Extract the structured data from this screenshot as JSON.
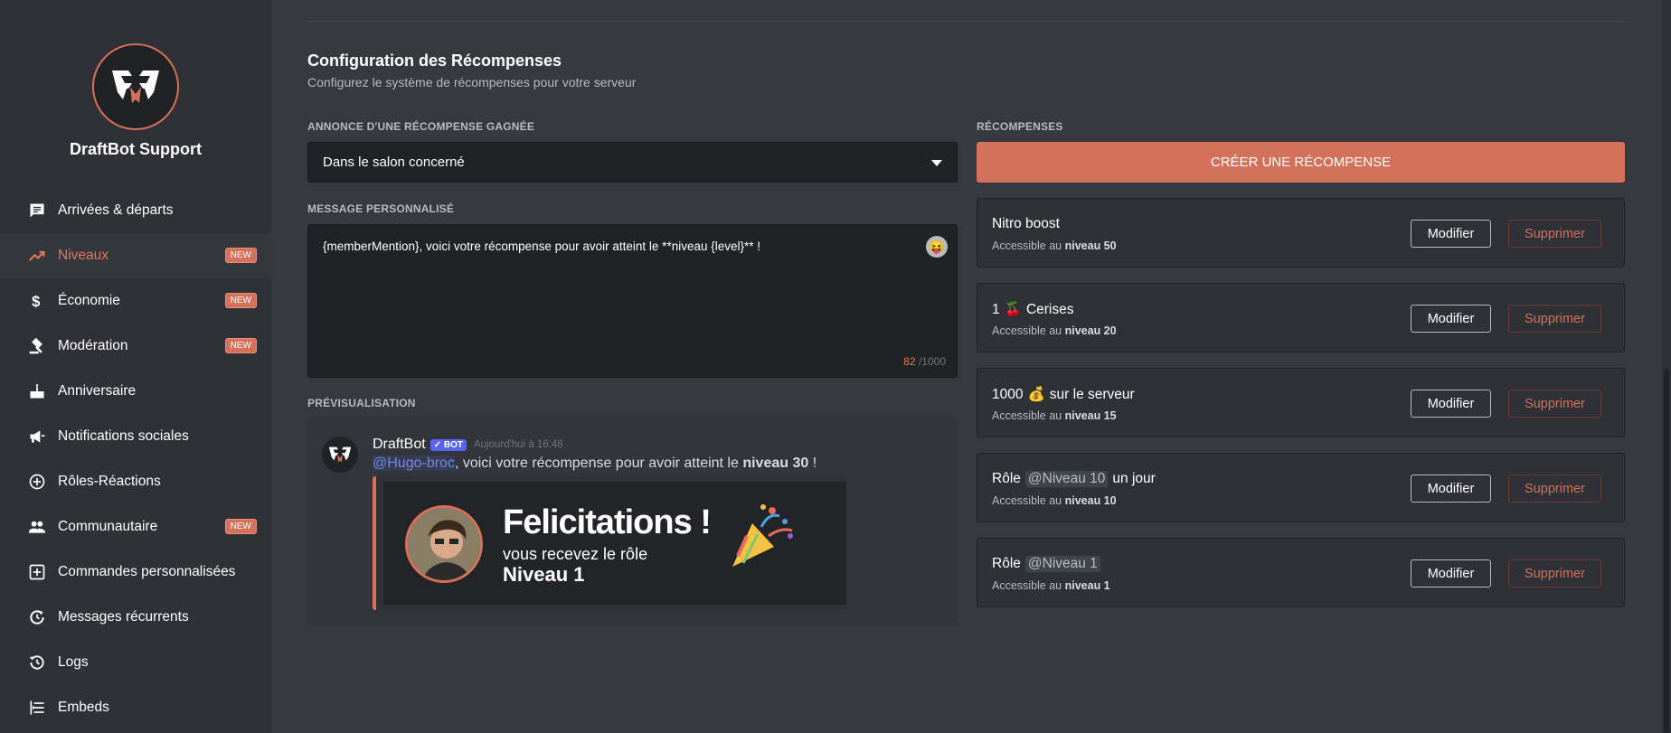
{
  "sidebar": {
    "server_name": "DraftBot Support",
    "items": [
      {
        "label": "Arrivées & départs",
        "icon": "message-icon",
        "badge": ""
      },
      {
        "label": "Niveaux",
        "icon": "trending-up-icon",
        "badge": "NEW"
      },
      {
        "label": "Économie",
        "icon": "dollar-icon",
        "badge": "NEW"
      },
      {
        "label": "Modération",
        "icon": "gavel-icon",
        "badge": "NEW"
      },
      {
        "label": "Anniversaire",
        "icon": "cake-icon",
        "badge": ""
      },
      {
        "label": "Notifications sociales",
        "icon": "megaphone-icon",
        "badge": ""
      },
      {
        "label": "Rôles-Réactions",
        "icon": "add-circle-icon",
        "badge": ""
      },
      {
        "label": "Communautaire",
        "icon": "people-icon",
        "badge": "NEW"
      },
      {
        "label": "Commandes personnalisées",
        "icon": "add-box-icon",
        "badge": ""
      },
      {
        "label": "Messages récurrents",
        "icon": "refresh-clock-icon",
        "badge": ""
      },
      {
        "label": "Logs",
        "icon": "history-icon",
        "badge": ""
      },
      {
        "label": "Embeds",
        "icon": "embed-icon",
        "badge": ""
      }
    ]
  },
  "main": {
    "title": "Configuration des Récompenses",
    "subtitle": "Configurez le système de récompenses pour votre serveur",
    "announce_label": "ANNONCE D'UNE RÉCOMPENSE GAGNÉE",
    "announce_value": "Dans le salon concerné",
    "message_label": "MESSAGE PERSONNALISÉ",
    "message_value": "{memberMention}, voici votre récompense pour avoir atteint le **niveau {level}** !",
    "counter_current": "82",
    "counter_max": "/1000",
    "preview_label": "PRÉVISUALISATION",
    "preview": {
      "author": "DraftBot",
      "bot_badge": "✓ BOT",
      "time": "Aujourd'hui à 16:48",
      "mention": "@Hugo-broc",
      "text_mid": ", voici votre récompense pour avoir atteint le ",
      "text_bold": "niveau 30",
      "text_end": " !",
      "embed_title": "Felicitations !",
      "embed_line1": "vous recevez le rôle",
      "embed_line2": "Niveau 1"
    }
  },
  "rewards": {
    "label": "RÉCOMPENSES",
    "create_label": "CRÉER UNE RÉCOMPENSE",
    "modify_label": "Modifier",
    "delete_label": "Supprimer",
    "access_prefix": "Accessible au ",
    "items": [
      {
        "name_pre": "Nitro boost",
        "emoji": "",
        "role": "",
        "name_post": "",
        "level": "niveau 50"
      },
      {
        "name_pre": "1",
        "emoji": "🍒",
        "role": "",
        "name_post": "Cerises",
        "level": "niveau 20"
      },
      {
        "name_pre": "1000",
        "emoji": "💰",
        "role": "",
        "name_post": "sur le serveur",
        "level": "niveau 15"
      },
      {
        "name_pre": "Rôle",
        "emoji": "",
        "role": "@Niveau 10",
        "name_post": "un jour",
        "level": "niveau 10"
      },
      {
        "name_pre": "Rôle",
        "emoji": "",
        "role": "@Niveau 1",
        "name_post": "",
        "level": "niveau 1"
      }
    ]
  },
  "colors": {
    "accent": "#d4715a",
    "bg": "#36393f",
    "sidebar": "#2f3136",
    "mention": "#7289da"
  }
}
